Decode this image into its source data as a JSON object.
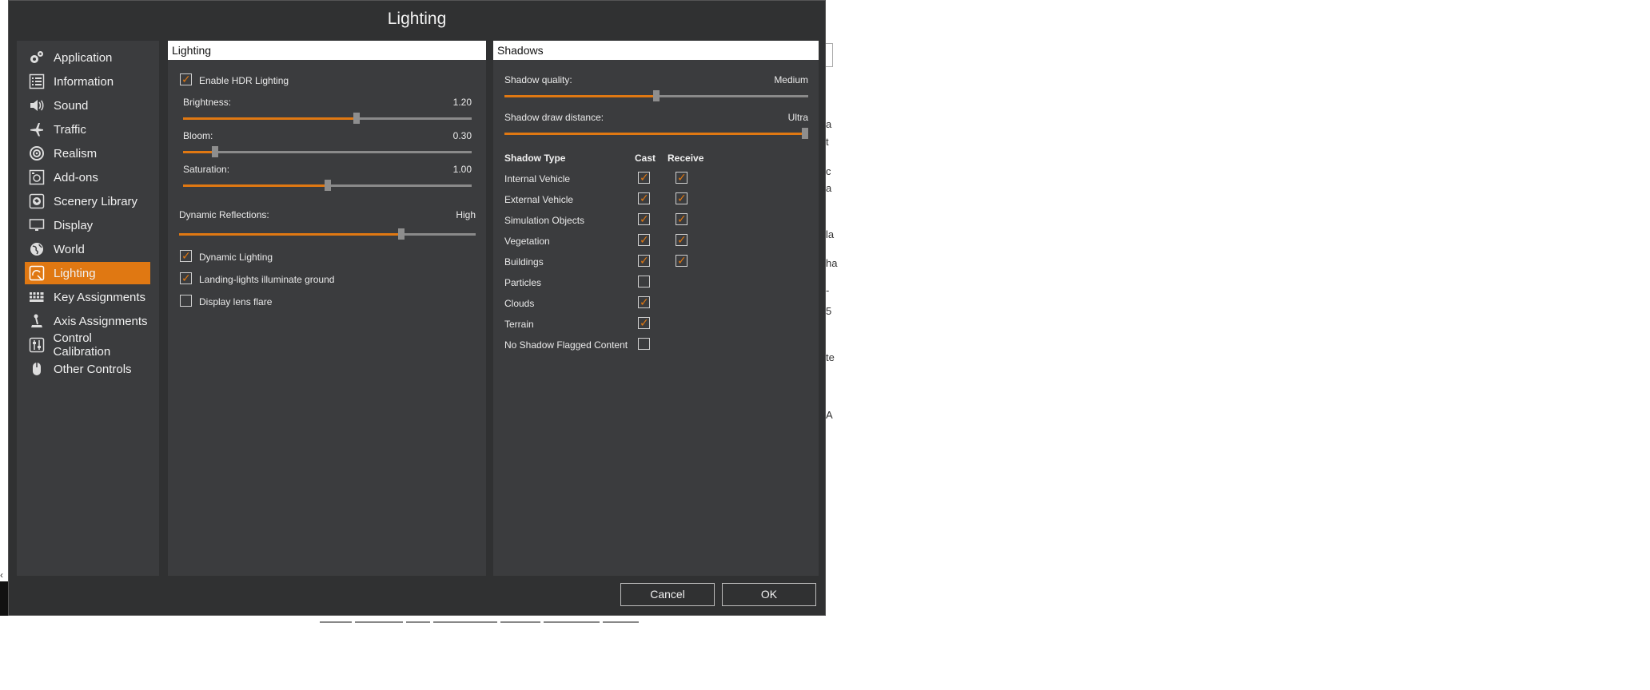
{
  "window": {
    "title": "Lighting"
  },
  "sidebar": {
    "items": [
      {
        "label": "Application",
        "icon": "gears-icon",
        "active": false
      },
      {
        "label": "Information",
        "icon": "list-icon",
        "active": false
      },
      {
        "label": "Sound",
        "icon": "speaker-icon",
        "active": false
      },
      {
        "label": "Traffic",
        "icon": "planes-icon",
        "active": false
      },
      {
        "label": "Realism",
        "icon": "target-icon",
        "active": false
      },
      {
        "label": "Add-ons",
        "icon": "addons-icon",
        "active": false
      },
      {
        "label": "Scenery Library",
        "icon": "scenery-icon",
        "active": false
      },
      {
        "label": "Display",
        "icon": "monitor-icon",
        "active": false
      },
      {
        "label": "World",
        "icon": "globe-icon",
        "active": false
      },
      {
        "label": "Lighting",
        "icon": "lighting-icon",
        "active": true
      },
      {
        "label": "Key Assignments",
        "icon": "keyboard-icon",
        "active": false
      },
      {
        "label": "Axis Assignments",
        "icon": "joystick-icon",
        "active": false
      },
      {
        "label": "Control Calibration",
        "icon": "sliders-icon",
        "active": false
      },
      {
        "label": "Other Controls",
        "icon": "mouse-icon",
        "active": false
      }
    ]
  },
  "lighting": {
    "header": "Lighting",
    "enable_hdr": {
      "label": "Enable HDR Lighting",
      "checked": true
    },
    "brightness": {
      "label": "Brightness:",
      "value": "1.20",
      "fraction": 0.6
    },
    "bloom": {
      "label": "Bloom:",
      "value": "0.30",
      "fraction": 0.11
    },
    "saturation": {
      "label": "Saturation:",
      "value": "1.00",
      "fraction": 0.5
    },
    "reflections": {
      "label": "Dynamic Reflections:",
      "value": "High",
      "fraction": 0.75
    },
    "dynamic_lighting": {
      "label": "Dynamic Lighting",
      "checked": true
    },
    "landing_lights": {
      "label": "Landing-lights illuminate ground",
      "checked": true
    },
    "lens_flare": {
      "label": "Display lens flare",
      "checked": false
    }
  },
  "shadows": {
    "header": "Shadows",
    "quality": {
      "label": "Shadow quality:",
      "value": "Medium",
      "fraction": 0.5
    },
    "distance": {
      "label": "Shadow draw distance:",
      "value": "Ultra",
      "fraction": 1.0
    },
    "columns": {
      "type": "Shadow Type",
      "cast": "Cast",
      "receive": "Receive"
    },
    "rows": [
      {
        "label": "Internal Vehicle",
        "cast": true,
        "receive": true,
        "has_receive": true
      },
      {
        "label": "External Vehicle",
        "cast": true,
        "receive": true,
        "has_receive": true
      },
      {
        "label": "Simulation Objects",
        "cast": true,
        "receive": true,
        "has_receive": true
      },
      {
        "label": "Vegetation",
        "cast": true,
        "receive": true,
        "has_receive": true
      },
      {
        "label": "Buildings",
        "cast": true,
        "receive": true,
        "has_receive": true
      },
      {
        "label": "Particles",
        "cast": false,
        "has_receive": false
      },
      {
        "label": "Clouds",
        "cast": true,
        "has_receive": false
      },
      {
        "label": "Terrain",
        "cast": true,
        "has_receive": false
      },
      {
        "label": "No Shadow Flagged Content",
        "cast": false,
        "has_receive": false
      }
    ]
  },
  "buttons": {
    "cancel": "Cancel",
    "ok": "OK"
  },
  "colors": {
    "accent": "#e07812",
    "panel": "#3b3c3e",
    "window": "#303132"
  }
}
